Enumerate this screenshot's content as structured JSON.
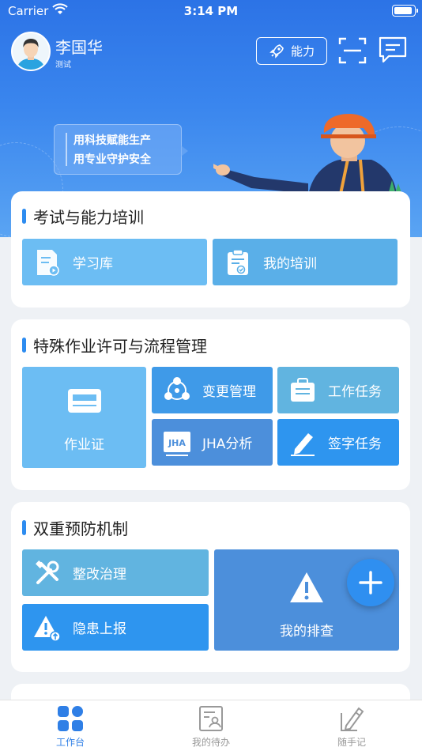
{
  "status_bar": {
    "carrier": "Carrier",
    "time": "3:14 PM"
  },
  "user": {
    "name": "李国华",
    "role": "测试"
  },
  "header": {
    "ability_label": "能力"
  },
  "banner": {
    "line1": "用科技赋能生产",
    "line2": "用专业守护安全"
  },
  "sections": {
    "training": {
      "title": "考试与能力培训",
      "items": [
        {
          "label": "学习库",
          "icon": "study-library-icon"
        },
        {
          "label": "我的培训",
          "icon": "clipboard-check-icon"
        }
      ]
    },
    "permits": {
      "title": "特殊作业许可与流程管理",
      "items": [
        {
          "label": "作业证",
          "icon": "certificate-card-icon"
        },
        {
          "label": "变更管理",
          "icon": "share-flow-icon"
        },
        {
          "label": "工作任务",
          "icon": "briefcase-task-icon"
        },
        {
          "label": "JHA分析",
          "icon": "jha-doc-icon"
        },
        {
          "label": "签字任务",
          "icon": "pen-sign-icon"
        }
      ]
    },
    "prevention": {
      "title": "双重预防机制",
      "items": [
        {
          "label": "整改治理",
          "icon": "tools-icon"
        },
        {
          "label": "隐患上报",
          "icon": "warning-upload-icon"
        },
        {
          "label": "我的排查",
          "icon": "warning-icon"
        }
      ]
    }
  },
  "tabbar": {
    "tabs": [
      {
        "label": "工作台",
        "icon": "dashboard-icon",
        "active": true
      },
      {
        "label": "我的待办",
        "icon": "todo-profile-icon",
        "active": false
      },
      {
        "label": "随手记",
        "icon": "notepad-pen-icon",
        "active": false
      }
    ]
  },
  "colors": {
    "primary": "#2d8cf0",
    "header_top": "#2c73e6",
    "header_bottom": "#5aa4f3"
  }
}
